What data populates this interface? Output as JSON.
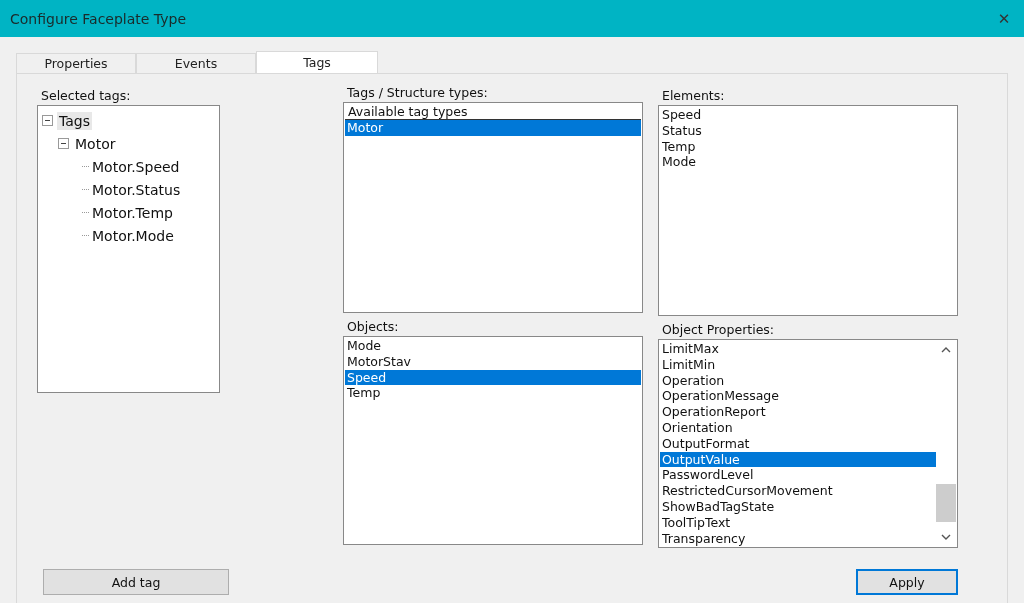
{
  "window": {
    "title": "Configure Faceplate Type",
    "close": "✕"
  },
  "tabs": [
    {
      "label": "Properties",
      "selected": false
    },
    {
      "label": "Events",
      "selected": false
    },
    {
      "label": "Tags",
      "selected": true
    }
  ],
  "selected_tags": {
    "label": "Selected tags:",
    "tree": [
      {
        "label": "Tags",
        "expanded": true,
        "selected": true,
        "children": [
          {
            "label": "Motor",
            "expanded": true,
            "selected": false,
            "children": [
              {
                "label": "Motor.Speed",
                "selected": false
              },
              {
                "label": "Motor.Status",
                "selected": false
              },
              {
                "label": "Motor.Temp",
                "selected": false
              },
              {
                "label": "Motor.Mode",
                "selected": false
              }
            ]
          }
        ]
      }
    ]
  },
  "add_tag_button": "Add tag",
  "tag_types": {
    "label": "Tags / Structure types:",
    "header": "Available tag types",
    "items": [
      {
        "label": "Motor",
        "selected": true
      }
    ]
  },
  "objects": {
    "label": "Objects:",
    "items": [
      {
        "label": "Mode",
        "selected": false
      },
      {
        "label": "MotorStav",
        "selected": false
      },
      {
        "label": "Speed",
        "selected": true
      },
      {
        "label": "Temp",
        "selected": false
      }
    ]
  },
  "elements": {
    "label": "Elements:",
    "items": [
      {
        "label": "Speed",
        "selected": false
      },
      {
        "label": "Status",
        "selected": false
      },
      {
        "label": "Temp",
        "selected": false
      },
      {
        "label": "Mode",
        "selected": false
      }
    ]
  },
  "object_properties": {
    "label": "Object Properties:",
    "items": [
      {
        "label": "LimitMax",
        "selected": false
      },
      {
        "label": "LimitMin",
        "selected": false
      },
      {
        "label": "Operation",
        "selected": false
      },
      {
        "label": "OperationMessage",
        "selected": false
      },
      {
        "label": "OperationReport",
        "selected": false
      },
      {
        "label": "Orientation",
        "selected": false
      },
      {
        "label": "OutputFormat",
        "selected": false
      },
      {
        "label": "OutputValue",
        "selected": true
      },
      {
        "label": "PasswordLevel",
        "selected": false
      },
      {
        "label": "RestrictedCursorMovement",
        "selected": false
      },
      {
        "label": "ShowBadTagState",
        "selected": false
      },
      {
        "label": "ToolTipText",
        "selected": false
      },
      {
        "label": "Transparency",
        "selected": false
      }
    ]
  },
  "apply_button": "Apply"
}
